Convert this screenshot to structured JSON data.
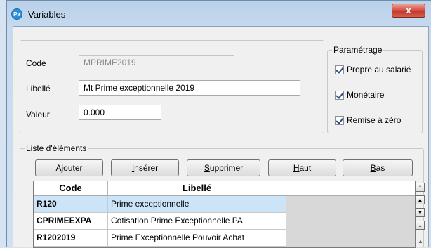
{
  "window": {
    "title": "Variables",
    "app_icon_text": "Pa",
    "close_label": "x"
  },
  "form": {
    "code_label": "Code",
    "code_value": "MPRIME2019",
    "libelle_label": "Libellé",
    "libelle_value": "Mt Prime exceptionnelle 2019",
    "valeur_label": "Valeur",
    "valeur_value": "0.000"
  },
  "parametrage": {
    "legend": "Paramétrage",
    "options": [
      {
        "label": "Propre au salarié",
        "checked": true
      },
      {
        "label": "Monétaire",
        "checked": true
      },
      {
        "label": "Remise à zéro",
        "checked": true
      }
    ]
  },
  "liste": {
    "legend": "Liste d'éléments",
    "buttons": {
      "ajouter": "Ajouter",
      "inserer_u": "I",
      "inserer_rest": "nsérer",
      "supprimer_u": "S",
      "supprimer_rest": "upprimer",
      "haut_u": "H",
      "haut_rest": "aut",
      "bas_u": "B",
      "bas_rest": "as"
    },
    "columns": [
      "Code",
      "Libellé"
    ],
    "rows": [
      {
        "code": "R120",
        "libelle": "Prime exceptionnelle",
        "selected": true
      },
      {
        "code": "CPRIMEEXPA",
        "libelle": "Cotisation Prime Exceptionnelle PA",
        "selected": false
      },
      {
        "code": "R1202019",
        "libelle": "Prime Exceptionnelle Pouvoir Achat",
        "selected": false
      }
    ]
  },
  "icons": [
    "app-logo-icon",
    "close-icon",
    "checkbox-checked-icon",
    "move-top-icon",
    "move-up-icon",
    "move-down-icon",
    "move-bottom-icon"
  ]
}
